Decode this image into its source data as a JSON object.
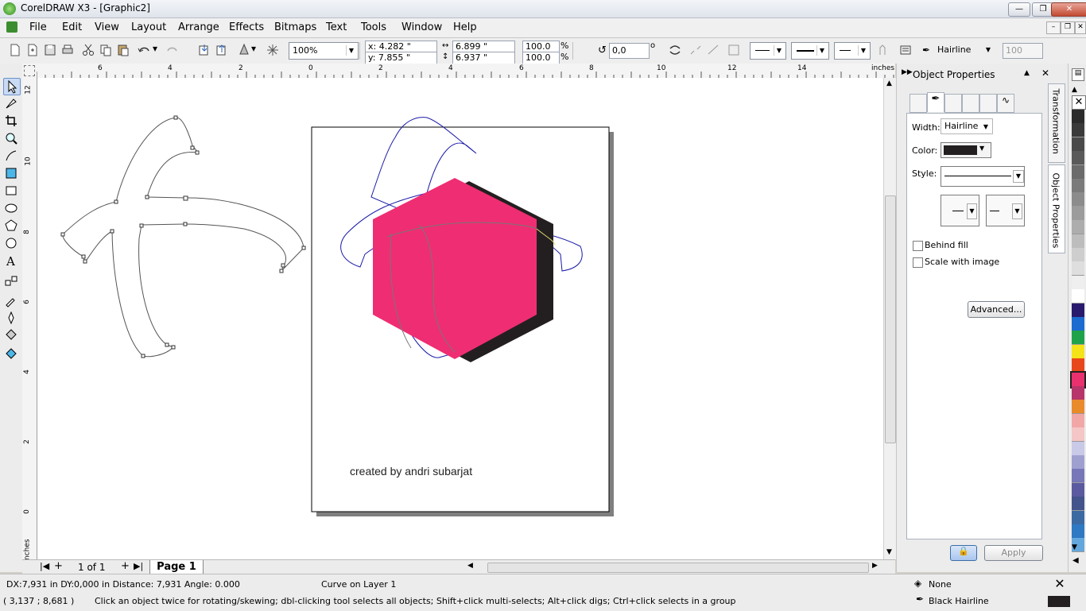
{
  "window": {
    "title": "CorelDRAW X3 - [Graphic2]"
  },
  "menu": [
    "File",
    "Edit",
    "View",
    "Layout",
    "Arrange",
    "Effects",
    "Bitmaps",
    "Text",
    "Tools",
    "Window",
    "Help"
  ],
  "toolbar": {
    "zoom": "100%",
    "x": "x: 4.282 \"",
    "y": "y: 7.855 \"",
    "w": "6.899 \"",
    "h": "6.937 \"",
    "scale_x": "100.0",
    "scale_y": "100.0",
    "pct1": "%",
    "pct2": "%",
    "angle": "0,0",
    "deg": "o",
    "outline": "Hairline",
    "opacity": "100"
  },
  "rulers": {
    "h_ticks": [
      "6",
      "4",
      "2",
      "0",
      "2",
      "4",
      "6",
      "8",
      "10",
      "12",
      "14"
    ],
    "h_unit": "inches",
    "v_ticks": [
      "12",
      "10",
      "8",
      "6",
      "4",
      "2",
      "0"
    ],
    "v_unit": "inches"
  },
  "canvas": {
    "credit": "created by andri subarjat"
  },
  "pagebar": {
    "count": "1 of 1",
    "page_tab": "Page 1"
  },
  "docker": {
    "title": "Object Properties",
    "width_label": "Width:",
    "width_value": "Hairline",
    "color_label": "Color:",
    "style_label": "Style:",
    "behind_fill": "Behind fill",
    "scale_with_image": "Scale with image",
    "advanced": "Advanced...",
    "apply": "Apply",
    "tab_transformation": "Transformation",
    "tab_object_properties": "Object Properties"
  },
  "palette": [
    "#2b2b2b",
    "#3a3a3a",
    "#4a4a4a",
    "#5a5a5a",
    "#6b6b6b",
    "#7b7b7b",
    "#8c8c8c",
    "#9c9c9c",
    "#adadad",
    "#bdbdbd",
    "#cecece",
    "#dedede",
    "#efefef",
    "#ffffff",
    "#2a1a6e",
    "#1c6bd0",
    "#1fa34a",
    "#f4e318",
    "#e8471b",
    "#e8316e",
    "#b7356a",
    "#e98a2b",
    "#f2a7a7",
    "#f4c6c6",
    "#c9c9e8",
    "#9f9fd0",
    "#7676b8",
    "#5a5aa0",
    "#43538b",
    "#3b6aa3",
    "#2e78c4",
    "#64a7dc"
  ],
  "colors": {
    "hex_fill": "#ef2d72",
    "shadow": "#231f20",
    "outline_blue": "#1a1aa8"
  },
  "status": {
    "line1_left": "DX:7,931 in DY:0,000 in Distance: 7,931 Angle: 0.000",
    "line1_mid": "Curve on Layer 1",
    "fill_label": "None",
    "line2_left": "( 3,137 ; 8,681 )",
    "line2_mid": "Click an object twice for rotating/skewing; dbl-clicking tool selects all objects; Shift+click multi-selects; Alt+click digs; Ctrl+click selects in a group",
    "outline_label": "Black  Hairline"
  }
}
